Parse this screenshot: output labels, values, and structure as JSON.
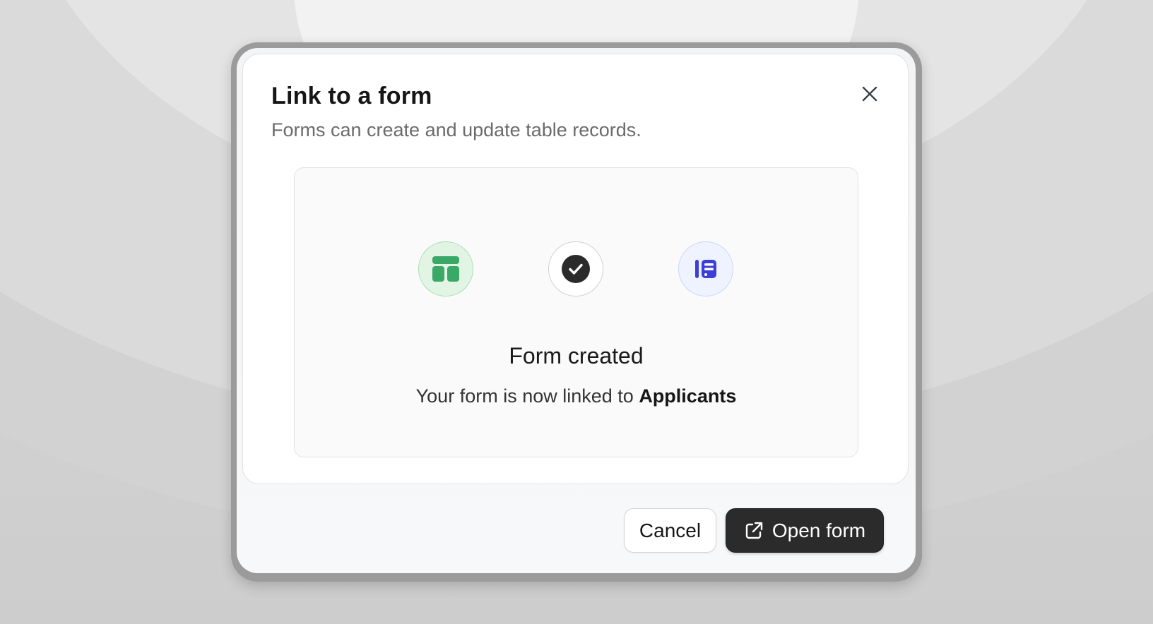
{
  "dialog": {
    "title": "Link to a form",
    "subtitle": "Forms can create and update table records.",
    "close_icon": "close-icon"
  },
  "status": {
    "title": "Form created",
    "message_prefix": "Your form is now linked to",
    "table_name": "Applicants"
  },
  "flow": {
    "nodes": [
      {
        "icon": "table-icon",
        "color": "#3aa866"
      },
      {
        "icon": "check-icon",
        "color": "#2b2b2b"
      },
      {
        "icon": "form-icon",
        "color": "#3b3fd8"
      }
    ],
    "connector_color": "#4cae7a"
  },
  "footer": {
    "cancel_label": "Cancel",
    "open_label": "Open form",
    "open_icon": "external-link-icon"
  }
}
